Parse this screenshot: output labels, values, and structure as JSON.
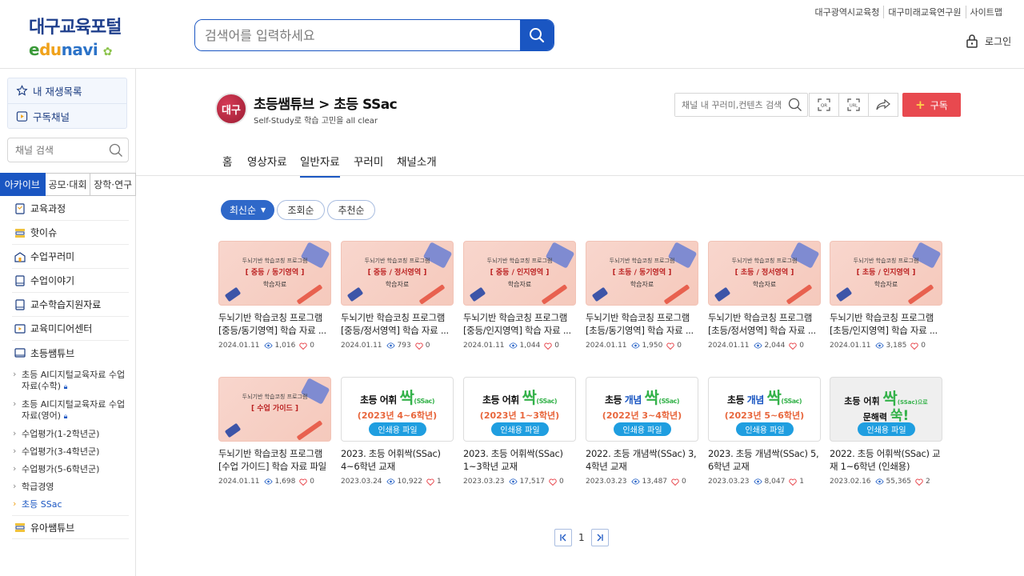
{
  "header": {
    "logo_top": "대구교육포털",
    "logo_e": "e",
    "logo_du": "du",
    "logo_navi": "navi",
    "search_placeholder": "검색어를 입력하세요",
    "top_links": [
      "대구광역시교육청",
      "대구미래교육연구원",
      "사이트맵"
    ],
    "login_label": "로그인"
  },
  "sidebar": {
    "my_playlist": "내 재생목록",
    "subscribed": "구독채널",
    "search_placeholder": "채널 검색",
    "tabs": [
      "아카이브",
      "공모·대회",
      "장학·연구"
    ],
    "menu": [
      "교육과정",
      "핫이슈",
      "수업꾸러미",
      "수업이야기",
      "교수학습지원자료",
      "교육미디어센터",
      "초등쌤튜브"
    ],
    "submenu": [
      "초등 AI디지털교육자료 수업자료(수학)",
      "초등 AI디지털교육자료 수업자료(영어)",
      "수업평가(1-2학년군)",
      "수업평가(3-4학년군)",
      "수업평가(5-6학년군)",
      "학급경영",
      "초등 SSac"
    ],
    "menu_last": "유아쌤튜브"
  },
  "channel": {
    "logo_text": "대구",
    "title": "초등쌤튜브 > 초등 SSac",
    "subtitle": "Self-Study로 학습 고민을 all clear",
    "search_placeholder": "채널 내 꾸러미,컨텐츠 검색",
    "subscribe_label": "구독",
    "tabs": [
      "홈",
      "영상자료",
      "일반자료",
      "꾸러미",
      "채널소개"
    ],
    "active_tab": "일반자료"
  },
  "sort": [
    "최신순",
    "조회순",
    "추천순"
  ],
  "cards": [
    {
      "title": "두뇌기반 학습코칭 프로그램 [중등/동기영역] 학습 자료 ...",
      "date": "2024.01.11",
      "views": "1,016",
      "likes": "0",
      "thumb_top": "두뇌기반 학습코칭 프로그램",
      "thumb_mid": "[ 중등 / 동기영역 ]",
      "thumb_bottom": "학습자료"
    },
    {
      "title": "두뇌기반 학습코칭 프로그램 [중등/정서영역] 학습 자료 ...",
      "date": "2024.01.11",
      "views": "793",
      "likes": "0",
      "thumb_top": "두뇌기반 학습코칭 프로그램",
      "thumb_mid": "[ 중등 / 정서영역 ]",
      "thumb_bottom": "학습자료"
    },
    {
      "title": "두뇌기반 학습코칭 프로그램 [중등/인지영역] 학습 자료 ...",
      "date": "2024.01.11",
      "views": "1,044",
      "likes": "0",
      "thumb_top": "두뇌기반 학습코칭 프로그램",
      "thumb_mid": "[ 중등 / 인지영역 ]",
      "thumb_bottom": "학습자료"
    },
    {
      "title": "두뇌기반 학습코칭 프로그램 [초등/동기영역] 학습 자료 ...",
      "date": "2024.01.11",
      "views": "1,950",
      "likes": "0",
      "thumb_top": "두뇌기반 학습코칭 프로그램",
      "thumb_mid": "[ 초등 / 동기영역 ]",
      "thumb_bottom": "학습자료"
    },
    {
      "title": "두뇌기반 학습코칭 프로그램 [초등/정서영역] 학습 자료 ...",
      "date": "2024.01.11",
      "views": "2,044",
      "likes": "0",
      "thumb_top": "두뇌기반 학습코칭 프로그램",
      "thumb_mid": "[ 초등 / 정서영역 ]",
      "thumb_bottom": "학습자료"
    },
    {
      "title": "두뇌기반 학습코칭 프로그램 [초등/인지영역] 학습 자료 ...",
      "date": "2024.01.11",
      "views": "3,185",
      "likes": "0",
      "thumb_top": "두뇌기반 학습코칭 프로그램",
      "thumb_mid": "[ 초등 / 인지영역 ]",
      "thumb_bottom": "학습자료"
    },
    {
      "title": "두뇌기반 학습코칭 프로그램 [수업 가이드] 학습 자료 파일",
      "date": "2024.01.11",
      "views": "1,698",
      "likes": "0",
      "thumb_top": "두뇌기반 학습코칭 프로그램",
      "thumb_mid": "[ 수업 가이드 ]",
      "thumb_bottom": ""
    },
    {
      "title": "2023. 초등 어휘싹(SSac) 4~6학년 교재",
      "date": "2023.03.24",
      "views": "10,922",
      "likes": "1",
      "thumb_word": "어휘",
      "thumb_ssac": "싹",
      "thumb_ss": "(SSac)",
      "thumb_grade": "(2023년 4~6학년)",
      "thumb_badge": "인쇄용 파일"
    },
    {
      "title": "2023. 초등 어휘싹(SSac) 1~3학년 교재",
      "date": "2023.03.23",
      "views": "17,517",
      "likes": "0",
      "thumb_word": "어휘",
      "thumb_ssac": "싹",
      "thumb_ss": "(SSac)",
      "thumb_grade": "(2023년 1~3학년)",
      "thumb_badge": "인쇄용 파일"
    },
    {
      "title": "2022. 초등 개념싹(SSac) 3, 4학년 교재",
      "date": "2023.03.23",
      "views": "13,487",
      "likes": "0",
      "thumb_word": "개념",
      "thumb_ssac": "싹",
      "thumb_ss": "(SSac)",
      "thumb_grade": "(2022년 3~4학년)",
      "thumb_badge": "인쇄용 파일"
    },
    {
      "title": "2023. 초등 개념싹(SSac) 5, 6학년 교재",
      "date": "2023.03.23",
      "views": "8,047",
      "likes": "1",
      "thumb_word": "개념",
      "thumb_ssac": "싹",
      "thumb_ss": "(SSac)",
      "thumb_grade": "(2023년 5~6학년)",
      "thumb_badge": "인쇄용 파일"
    },
    {
      "title": "2022. 초등 어휘싹(SSac) 교재 1~6학년 (인쇄용)",
      "date": "2023.02.16",
      "views": "55,365",
      "likes": "2",
      "thumb_word": "어휘",
      "thumb_ssac": "싹",
      "thumb_ss": "(SSac)으로",
      "thumb_line2": "문해력",
      "thumb_ssac2": "쑥!",
      "thumb_badge": "인쇄용 파일"
    }
  ],
  "pagination": {
    "current": "1"
  },
  "colors": {
    "primary": "#1a56c2",
    "subscribe": "#e8494f",
    "ssac_green": "#34b24a"
  }
}
